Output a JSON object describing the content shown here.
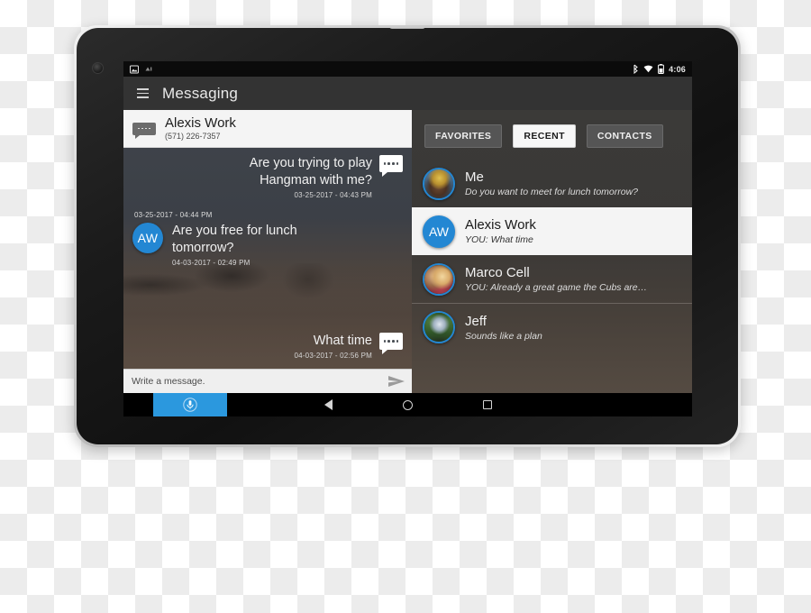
{
  "device": {
    "type": "android-tablet"
  },
  "status_bar": {
    "left_icons": [
      "screenshot-icon",
      "android-beam-icon"
    ],
    "right_icons": [
      "bluetooth-icon",
      "wifi-icon",
      "battery-icon"
    ],
    "time": "4:06"
  },
  "app_bar": {
    "menu_icon": "hamburger-menu-icon",
    "title": "Messaging"
  },
  "conversation": {
    "header": {
      "icon": "message-bubble-icon",
      "name": "Alexis Work",
      "number": "(571) 226-7357"
    },
    "messages": [
      {
        "direction": "outgoing",
        "text": "Are you trying to play Hangman with me?",
        "time": "03-25-2017 - 04:43 PM",
        "icon": "message-bubble-icon"
      },
      {
        "direction": "incoming",
        "standalone_time": "03-25-2017 - 04:44 PM",
        "avatar_initials": "AW",
        "text": "Are you free for lunch tomorrow?",
        "time": "04-03-2017 - 02:49 PM"
      },
      {
        "direction": "outgoing",
        "text": "What time",
        "time": "04-03-2017 - 02:56 PM",
        "icon": "message-bubble-icon"
      }
    ],
    "composer": {
      "placeholder": "Write a message.",
      "value": "",
      "send_icon": "send-arrow-icon"
    }
  },
  "contacts_pane": {
    "tabs": [
      {
        "label": "FAVORITES",
        "active": false
      },
      {
        "label": "RECENT",
        "active": true
      },
      {
        "label": "CONTACTS",
        "active": false
      }
    ],
    "items": [
      {
        "name": "Me",
        "preview": "Do you want to meet for lunch tomorrow?",
        "avatar": "photo-me",
        "selected": false
      },
      {
        "name": "Alexis Work",
        "preview": "YOU: What time",
        "avatar": "initials-AW",
        "initials": "AW",
        "selected": true
      },
      {
        "name": "Marco Cell",
        "preview": "YOU: Already a great game the Cubs are…",
        "avatar": "photo-marco",
        "selected": false
      },
      {
        "name": "Jeff",
        "preview": "Sounds like a plan",
        "avatar": "photo-jeff",
        "selected": false
      }
    ]
  },
  "nav_bar": {
    "mic_icon": "microphone-icon",
    "back_icon": "back-triangle-icon",
    "home_icon": "home-circle-icon",
    "recents_icon": "recents-square-icon"
  },
  "colors": {
    "accent_blue": "#2387d3",
    "mic_blue": "#2b98de",
    "app_bar": "#333333",
    "status_bar": "#0b0b0b",
    "selected_row": "#f4f4f4"
  }
}
